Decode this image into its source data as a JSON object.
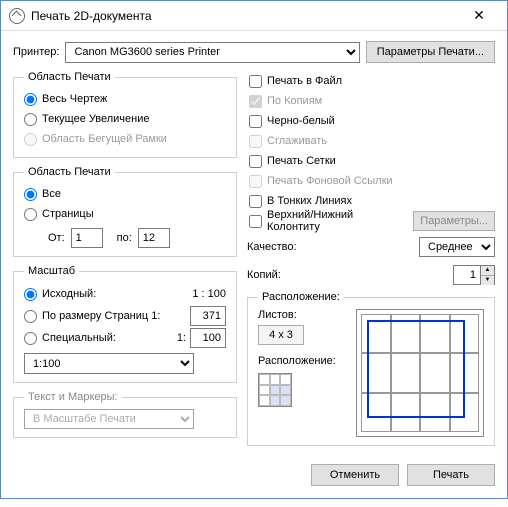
{
  "window": {
    "title": "Печать 2D-документа"
  },
  "printer": {
    "label": "Принтер:",
    "value": "Canon MG3600 series Printer",
    "params_btn": "Параметры Печати..."
  },
  "area1": {
    "legend": "Область Печати",
    "whole": "Весь Чертеж",
    "zoom": "Текущее Увеличение",
    "marquee": "Область Бегущей Рамки"
  },
  "area2": {
    "legend": "Область Печати",
    "all": "Все",
    "pages": "Страницы",
    "from_label": "От:",
    "from_value": "1",
    "to_label": "по:",
    "to_value": "12"
  },
  "scale": {
    "legend": "Масштаб",
    "original": "Исходный:",
    "original_ratio": "1 : 100",
    "fit": "По размеру Страниц 1:",
    "fit_value": "371",
    "special": "Специальный:",
    "special_prefix": "1:",
    "special_value": "100",
    "select_value": "1:100"
  },
  "markers": {
    "legend": "Текст и Маркеры:",
    "select_value": "В Масштабе Печати"
  },
  "checks": {
    "to_file": "Печать в Файл",
    "collate": "По Копиям",
    "bw": "Черно-белый",
    "aa": "Сглаживать",
    "grid": "Печать Сетки",
    "bg_link": "Печать Фоновой Ссылки",
    "hairline": "В Тонких Линиях",
    "header": "Верхний/Нижний Колонтиту",
    "header_btn": "Параметры..."
  },
  "quality": {
    "label": "Качество:",
    "value": "Среднее"
  },
  "copies": {
    "label": "Копий:",
    "value": "1"
  },
  "layout": {
    "legend": "Расположение:",
    "sheets_label": "Листов:",
    "sheets_value": "4 x 3",
    "pos_label": "Расположение:"
  },
  "footer": {
    "cancel": "Отменить",
    "print": "Печать"
  }
}
